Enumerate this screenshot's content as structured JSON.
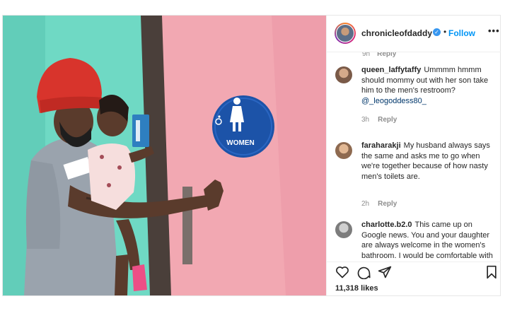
{
  "post": {
    "username": "chronicleofdaddy",
    "separator": "•",
    "follow_label": "Follow",
    "more_label": "•••",
    "verified_mark": "✓",
    "sign_text": "WOMEN"
  },
  "truncated_comment": {
    "time": "9h",
    "reply": "Reply"
  },
  "comments": [
    {
      "username": "queen_laffytaffy",
      "text": "Ummmm hmmm should mommy out with her son take him to the men's restroom?",
      "mention": "@_leogoddess80_",
      "time": "3h",
      "reply": "Reply"
    },
    {
      "username": "faraharakji",
      "text": "My husband always says the same and asks me to go when we're together because of how nasty men's toilets are.",
      "time": "2h",
      "reply": "Reply"
    },
    {
      "username": "charlotte.b2.0",
      "text": "This came up on Google news. You and your daughter are always welcome in the women's bathroom. I would be comfortable with what you are doing. I take my boys in"
    }
  ],
  "likes": "11,318 likes",
  "icons": [
    "heart-icon",
    "comment-icon",
    "share-icon",
    "bookmark-icon",
    "user-avatar"
  ],
  "colors": {
    "accent": "#0095f6",
    "verified": "#3897f0",
    "door": "#f2a8b2",
    "wall": "#6fd9c4",
    "sign": "#1c53a8"
  }
}
